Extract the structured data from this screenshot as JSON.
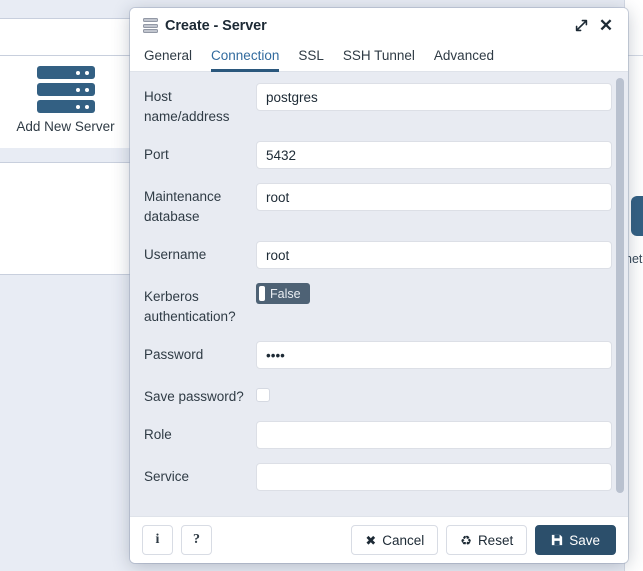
{
  "background": {
    "add_server_tile": {
      "label": "Add New Server",
      "icon": "server-stack-icon"
    },
    "right_edge_text": "net",
    "accent_color": "#336083"
  },
  "dialog": {
    "title": "Create - Server",
    "title_icon": "server-stack-icon",
    "titlebar_buttons": [
      {
        "name": "maximize",
        "icon": "expand-diagonal-icon"
      },
      {
        "name": "close",
        "icon": "close-icon",
        "glyph": "✕"
      }
    ],
    "tabs": [
      {
        "label": "General",
        "active": false
      },
      {
        "label": "Connection",
        "active": true
      },
      {
        "label": "SSL",
        "active": false
      },
      {
        "label": "SSH Tunnel",
        "active": false
      },
      {
        "label": "Advanced",
        "active": false
      }
    ],
    "active_tab_color": "#326b9e",
    "fields": [
      {
        "label": "Host name/address",
        "type": "text",
        "value": "postgres",
        "placeholder": ""
      },
      {
        "label": "Port",
        "type": "text",
        "value": "5432",
        "placeholder": ""
      },
      {
        "label": "Maintenance database",
        "type": "text",
        "value": "root",
        "placeholder": ""
      },
      {
        "label": "Username",
        "type": "text",
        "value": "root",
        "placeholder": ""
      },
      {
        "label": "Kerberos authentication?",
        "type": "toggle",
        "value": "False"
      },
      {
        "label": "Password",
        "type": "password",
        "value": "••••",
        "placeholder": ""
      },
      {
        "label": "Save password?",
        "type": "checkbox",
        "checked": false
      },
      {
        "label": "Role",
        "type": "text",
        "value": "",
        "placeholder": ""
      },
      {
        "label": "Service",
        "type": "text",
        "value": "",
        "placeholder": ""
      }
    ],
    "footer": {
      "info_label": "i",
      "help_label": "?",
      "cancel_label": "Cancel",
      "cancel_glyph": "✖",
      "reset_label": "Reset",
      "reset_glyph": "♻",
      "save_label": "Save",
      "save_color": "#2c4f6b"
    }
  }
}
